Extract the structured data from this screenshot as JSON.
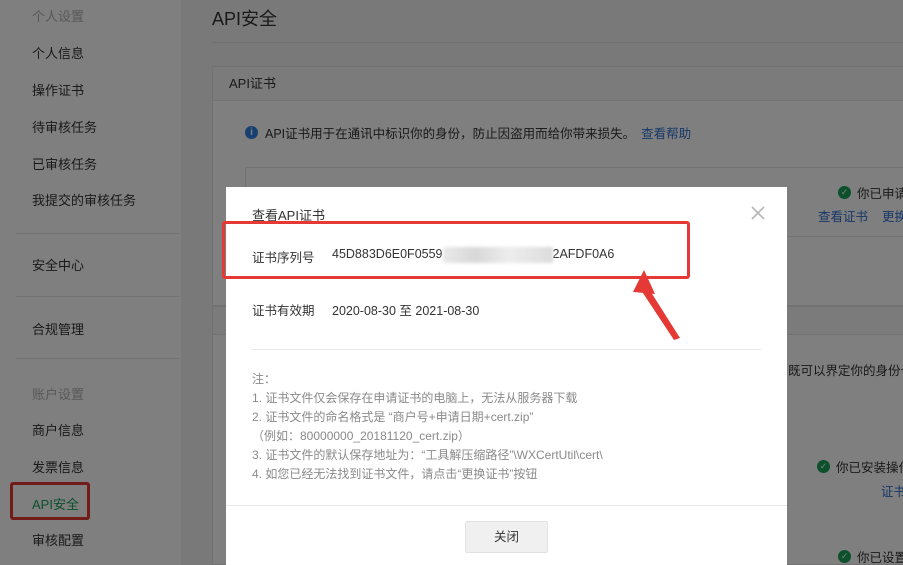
{
  "sidebar": {
    "group_personal": "个人设置",
    "items_personal": [
      "个人信息",
      "操作证书",
      "待审核任务",
      "已审核任务",
      "我提交的审核任务"
    ],
    "security_center": "安全中心",
    "compliance": "合规管理",
    "group_account": "账户设置",
    "items_account": [
      "商户信息",
      "发票信息",
      "API安全",
      "审核配置"
    ]
  },
  "main": {
    "title": "API安全",
    "panel_title": "API证书",
    "info_text": "API证书用于在通讯中标识你的身份，防止因盗用而给你带来损失。",
    "info_link": "查看帮助",
    "status_applied": "你已申请",
    "action_view": "查看证书",
    "action_replace": "更换",
    "side_text": "既可以界定你的身份也",
    "status_installed": "你已安装操作",
    "link_cert": "证书",
    "status_set": "你已设置"
  },
  "modal": {
    "title": "查看API证书",
    "serial_label": "证书序列号",
    "serial_prefix": "45D883D6E0F0559",
    "serial_suffix": "2AFDF0A6",
    "validity_label": "证书有效期",
    "validity_value": "2020-08-30 至 2021-08-30",
    "notes": [
      "注：",
      "1. 证书文件仅会保存在申请证书的电脑上，无法从服务器下载",
      "2. 证书文件的命名格式是 “商户号+申请日期+cert.zip”",
      "（例如：80000000_20181120_cert.zip）",
      "3. 证书文件的默认保存地址为：“工具解压缩路径”\\WXCertUtil\\cert\\",
      "4. 如您已经无法找到证书文件，请点击“更换证书”按钮"
    ],
    "close_button": "关闭"
  },
  "colors": {
    "accent_green": "#18a058",
    "link_blue": "#2f6ed1",
    "annotation_red": "#e53935"
  }
}
